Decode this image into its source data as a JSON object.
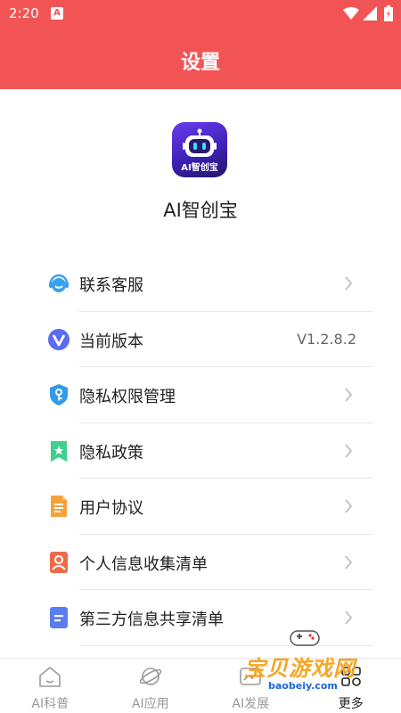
{
  "status_bar": {
    "time": "2:20",
    "a_badge": "A"
  },
  "header": {
    "title": "设置"
  },
  "app": {
    "name": "AI智创宝",
    "icon_text": "AI智创宝",
    "icon": "robot-icon"
  },
  "menu": [
    {
      "label": "联系客服",
      "icon": "customer-service-icon",
      "color": "#3aa0f0"
    },
    {
      "label": "当前版本",
      "icon": "version-icon",
      "value": "V1.2.8.2",
      "color": "#5b6cf0"
    },
    {
      "label": "隐私权限管理",
      "icon": "privacy-key-icon",
      "color": "#2f9be8"
    },
    {
      "label": "隐私政策",
      "icon": "bookmark-star-icon",
      "color": "#3ccf8e"
    },
    {
      "label": "用户协议",
      "icon": "document-icon",
      "color": "#f5a23a"
    },
    {
      "label": "个人信息收集清单",
      "icon": "person-icon",
      "color": "#f06a4a"
    },
    {
      "label": "第三方信息共享清单",
      "icon": "list-icon",
      "color": "#5b7df0"
    }
  ],
  "bottom_nav": [
    {
      "label": "AI科普",
      "icon": "home-icon"
    },
    {
      "label": "AI应用",
      "icon": "planet-icon"
    },
    {
      "label": "AI发展",
      "icon": "trend-icon"
    },
    {
      "label": "更多",
      "icon": "more-icon",
      "active": true
    }
  ],
  "watermark": {
    "text": "宝贝游戏网",
    "url": "baobeiy.com"
  },
  "colors": {
    "brand": "#f25455",
    "text": "#222222",
    "muted": "#9a9a9a"
  }
}
